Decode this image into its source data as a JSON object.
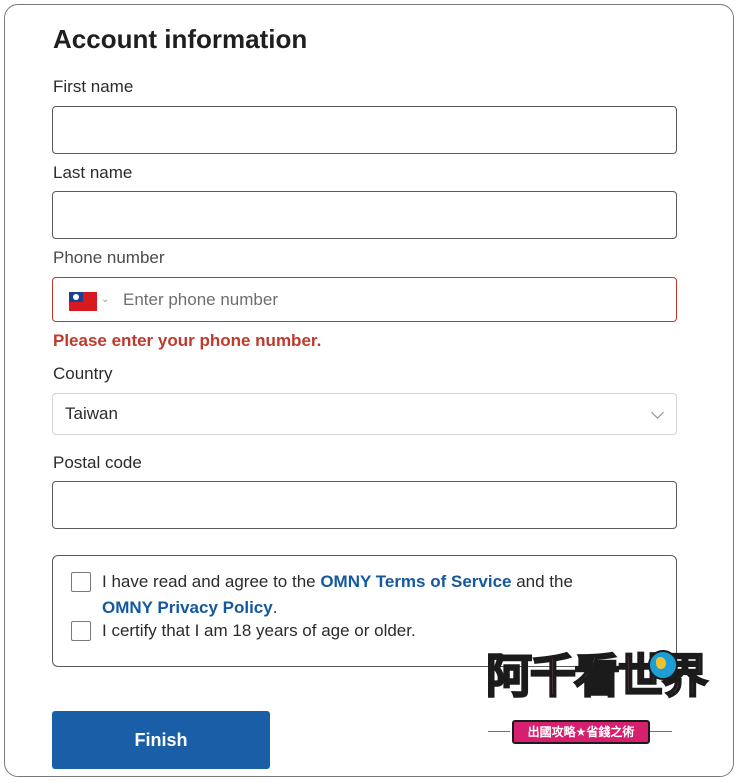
{
  "form": {
    "title": "Account information",
    "first_name": {
      "label": "First name",
      "value": ""
    },
    "last_name": {
      "label": "Last name",
      "value": ""
    },
    "phone": {
      "label": "Phone number",
      "country_flag": "taiwan-flag-icon",
      "placeholder": "Enter phone number",
      "value": "",
      "error": "Please enter your phone number."
    },
    "country": {
      "label": "Country",
      "selected": "Taiwan"
    },
    "postal_code": {
      "label": "Postal code",
      "value": ""
    },
    "agreements": {
      "terms_prefix": "I have read and agree to the ",
      "terms_link": "OMNY Terms of Service",
      "terms_middle": " and the",
      "privacy_link": "OMNY Privacy Policy",
      "privacy_suffix": ".",
      "age_text": "I certify that I am 18 years of age or older."
    },
    "finish_label": "Finish"
  },
  "watermark": {
    "logo_text": "阿千看世界",
    "ribbon_text": "出國攻略★省錢之術"
  },
  "colors": {
    "accent": "#1a5ea8",
    "link": "#14599e",
    "error": "#c0392b"
  }
}
